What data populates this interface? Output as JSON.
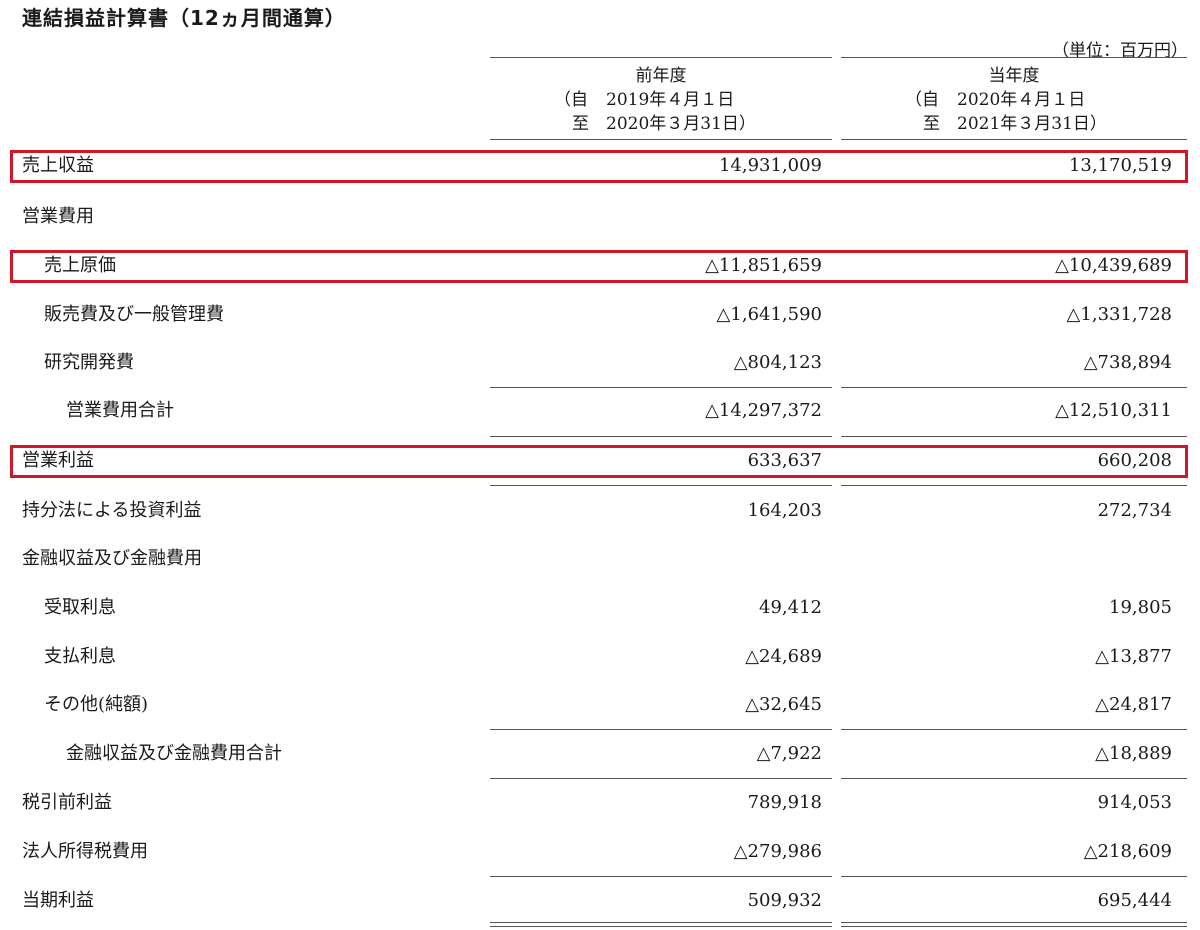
{
  "document": {
    "title": "連結損益計算書（12ヵ月間通算）",
    "unit": "（単位：百万円）"
  },
  "columns": [
    {
      "label": "前年度",
      "from_prefix": "（自",
      "from_date": "2019年４月１日",
      "to_prefix": "至",
      "to_date": "2020年３月31日）"
    },
    {
      "label": "当年度",
      "from_prefix": "（自",
      "from_date": "2020年４月１日",
      "to_prefix": "至",
      "to_date": "2021年３月31日）"
    }
  ],
  "rows": [
    {
      "label": "売上収益",
      "prev": "14,931,009",
      "curr": "13,170,519",
      "indent": 0,
      "highlight": true
    },
    {
      "label": "営業費用",
      "prev": "",
      "curr": "",
      "indent": 0,
      "highlight": false
    },
    {
      "label": "売上原価",
      "prev": "△11,851,659",
      "curr": "△10,439,689",
      "indent": 1,
      "highlight": true
    },
    {
      "label": "販売費及び一般管理費",
      "prev": "△1,641,590",
      "curr": "△1,331,728",
      "indent": 1,
      "highlight": false
    },
    {
      "label": "研究開発費",
      "prev": "△804,123",
      "curr": "△738,894",
      "indent": 1,
      "highlight": false
    },
    {
      "label": "営業費用合計",
      "prev": "△14,297,372",
      "curr": "△12,510,311",
      "indent": 2,
      "highlight": false
    },
    {
      "label": "営業利益",
      "prev": "633,637",
      "curr": "660,208",
      "indent": 0,
      "highlight": true
    },
    {
      "label": "持分法による投資利益",
      "prev": "164,203",
      "curr": "272,734",
      "indent": 0,
      "highlight": false
    },
    {
      "label": "金融収益及び金融費用",
      "prev": "",
      "curr": "",
      "indent": 0,
      "highlight": false
    },
    {
      "label": "受取利息",
      "prev": "49,412",
      "curr": "19,805",
      "indent": 1,
      "highlight": false
    },
    {
      "label": "支払利息",
      "prev": "△24,689",
      "curr": "△13,877",
      "indent": 1,
      "highlight": false
    },
    {
      "label": "その他(純額)",
      "prev": "△32,645",
      "curr": "△24,817",
      "indent": 1,
      "highlight": false
    },
    {
      "label": "金融収益及び金融費用合計",
      "prev": "△7,922",
      "curr": "△18,889",
      "indent": 2,
      "highlight": false
    },
    {
      "label": "税引前利益",
      "prev": "789,918",
      "curr": "914,053",
      "indent": 0,
      "highlight": false
    },
    {
      "label": "法人所得税費用",
      "prev": "△279,986",
      "curr": "△218,609",
      "indent": 0,
      "highlight": false
    },
    {
      "label": "当期利益",
      "prev": "509,932",
      "curr": "695,444",
      "indent": 0,
      "highlight": false
    }
  ],
  "colors": {
    "highlight_border": "#d0172a",
    "rule": "#555555",
    "text": "#1a1a1a"
  }
}
